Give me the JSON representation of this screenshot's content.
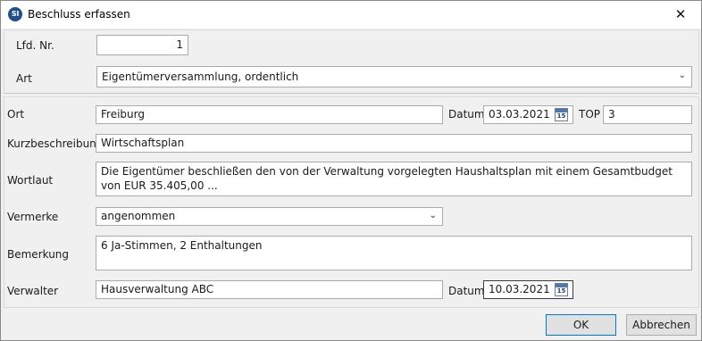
{
  "window": {
    "icon_text": "SI",
    "title": "Beschluss erfassen",
    "close_symbol": "✕"
  },
  "top_section": {
    "lfd_nr": {
      "label": "Lfd. Nr.",
      "value": "1"
    },
    "art": {
      "label": "Art",
      "value": "Eigentümerversammlung, ordentlich"
    }
  },
  "details": {
    "ort": {
      "label": "Ort",
      "value": "Freiburg"
    },
    "datum1": {
      "label": "Datum",
      "value": "03.03.2021"
    },
    "top": {
      "label": "TOP",
      "value": "3"
    },
    "kurzbeschreibung": {
      "label": "Kurzbeschreibung",
      "value": "Wirtschaftsplan"
    },
    "wortlaut": {
      "label": "Wortlaut",
      "value": "Die Eigentümer beschließen den von der Verwaltung vorgelegten Haushaltsplan mit einem Gesamtbudget von EUR 35.405,00 ..."
    },
    "vermerke": {
      "label": "Vermerke",
      "value": "angenommen"
    },
    "bemerkung": {
      "label": "Bemerkung",
      "value": "6 Ja-Stimmen, 2 Enthaltungen"
    },
    "verwalter": {
      "label": "Verwalter",
      "value": "Hausverwaltung ABC"
    },
    "datum2": {
      "label": "Datum",
      "value": "10.03.2021"
    }
  },
  "calendar_icon_number": "15",
  "combo_arrow": "⌄",
  "buttons": {
    "ok": "OK",
    "cancel": "Abbrechen"
  }
}
